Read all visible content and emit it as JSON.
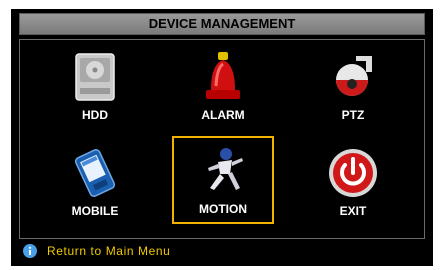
{
  "title": "DEVICE MANAGEMENT",
  "tiles": [
    {
      "label": "HDD",
      "icon": "hdd-icon"
    },
    {
      "label": "ALARM",
      "icon": "alarm-icon"
    },
    {
      "label": "PTZ",
      "icon": "ptz-icon"
    },
    {
      "label": "MOBILE",
      "icon": "mobile-icon"
    },
    {
      "label": "MOTION",
      "icon": "motion-icon"
    },
    {
      "label": "EXIT",
      "icon": "exit-icon"
    }
  ],
  "selected_tile": "MOTION",
  "status": {
    "text": "Return to Main Menu",
    "icon": "info-icon"
  },
  "colors": {
    "highlight": "#f0b400",
    "status_text": "#f0c800",
    "title_bar": "#8a8a8a"
  }
}
